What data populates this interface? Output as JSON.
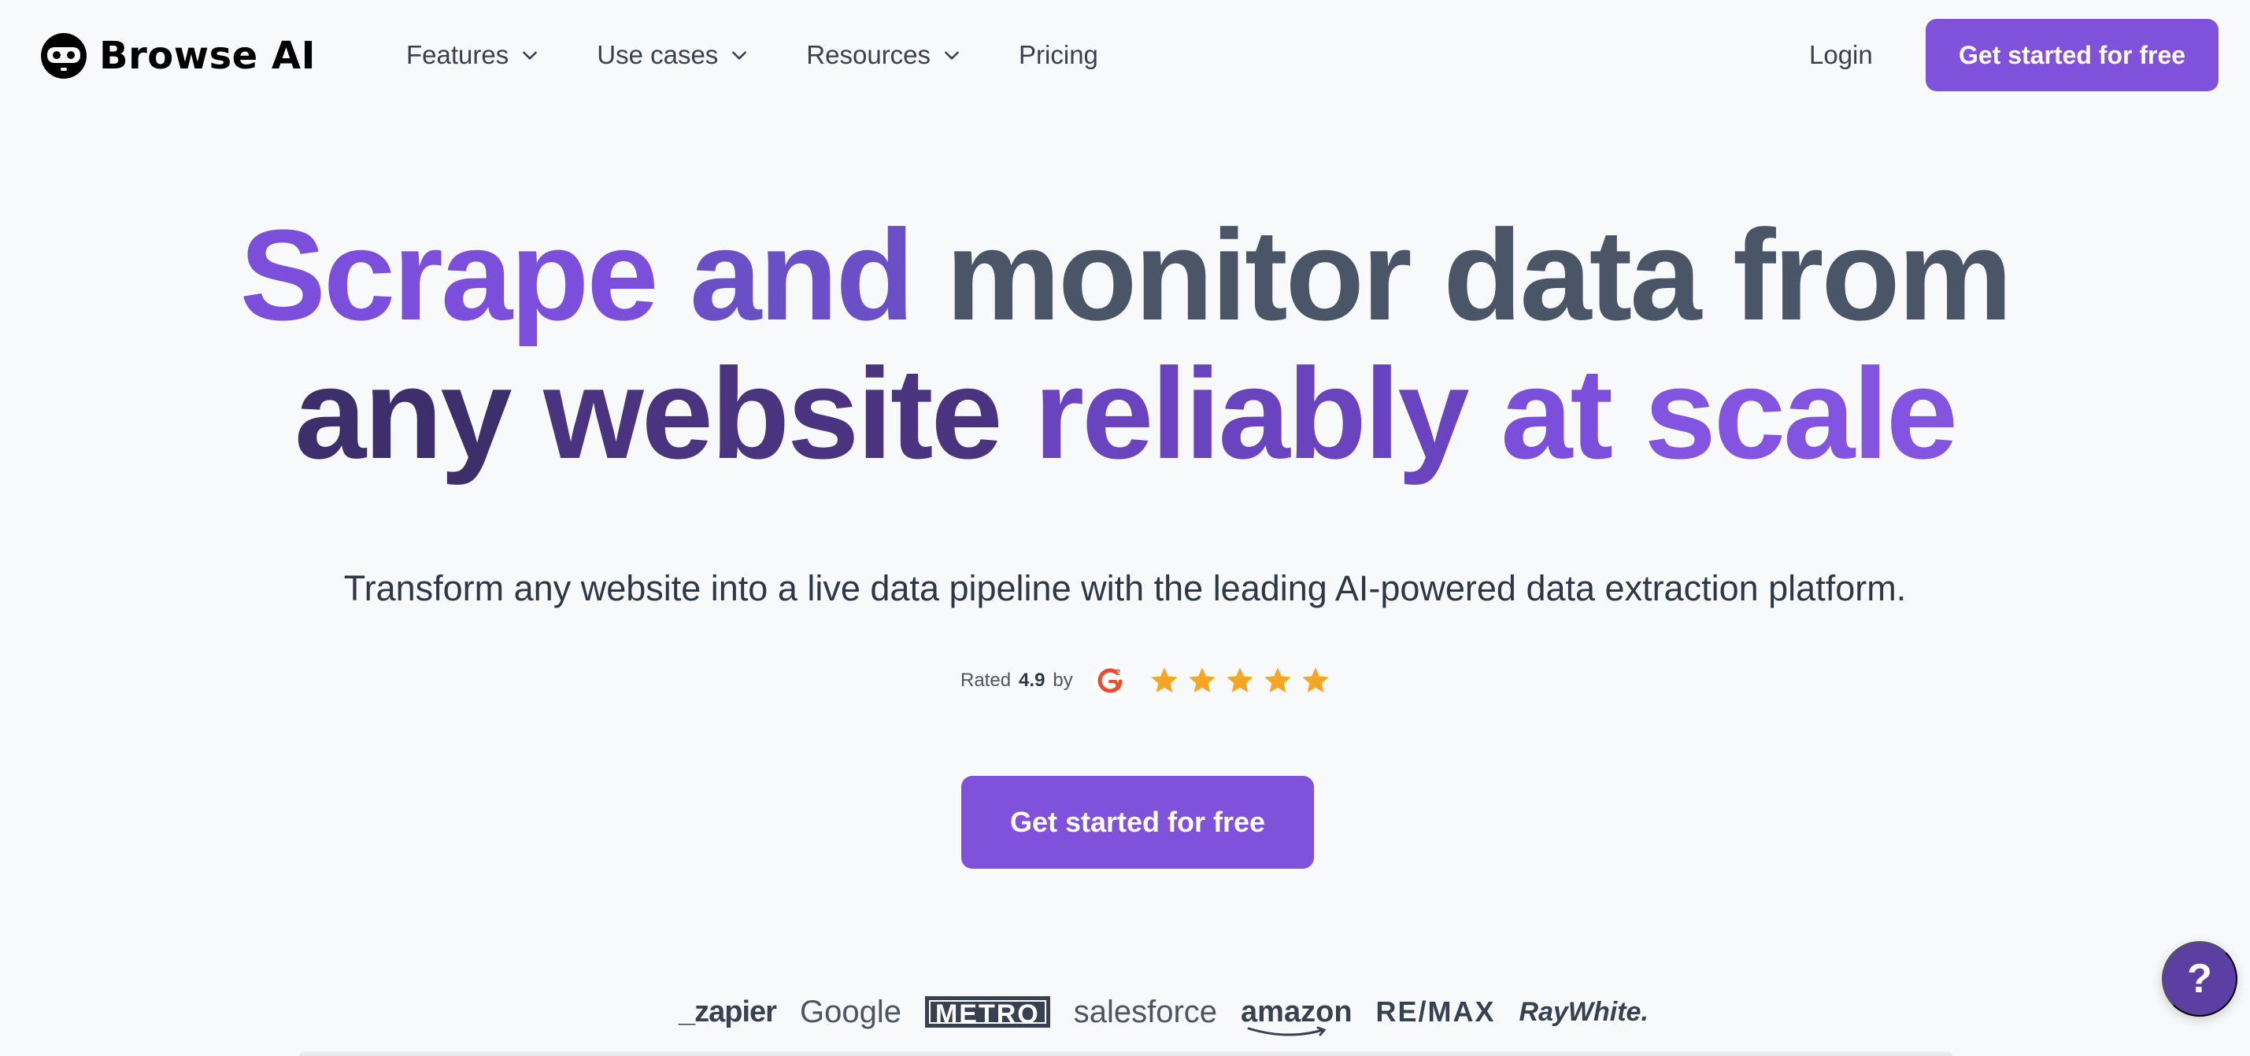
{
  "brand": {
    "name": "Browse AI",
    "logo_icon": "browse-ai-robot-icon"
  },
  "nav": {
    "items": [
      {
        "label": "Features",
        "has_dropdown": true
      },
      {
        "label": "Use cases",
        "has_dropdown": true
      },
      {
        "label": "Resources",
        "has_dropdown": true
      },
      {
        "label": "Pricing",
        "has_dropdown": false
      }
    ],
    "login_label": "Login",
    "cta_label": "Get started for free"
  },
  "hero": {
    "headline_line1": [
      "Scrape",
      "and",
      "monitor",
      "data",
      "from"
    ],
    "headline_line2": [
      "any",
      "website",
      "reliably",
      "at",
      "scale"
    ],
    "subtitle": "Transform any website into a live data pipeline with the leading AI-powered data extraction platform.",
    "rating": {
      "prefix": "Rated",
      "score": "4.9",
      "suffix": "by",
      "source_icon": "g2-logo-icon",
      "stars": 5
    },
    "cta_label": "Get started for free"
  },
  "customer_logos": [
    "_zapier",
    "Google",
    "METRO",
    "salesforce",
    "amazon",
    "RE/MAX",
    "RayWhite."
  ],
  "help_button": {
    "label": "?"
  },
  "colors": {
    "accent": "#8052dc",
    "help": "#5b3fa3",
    "background": "#f8f9fb",
    "star": "#f5a623"
  }
}
